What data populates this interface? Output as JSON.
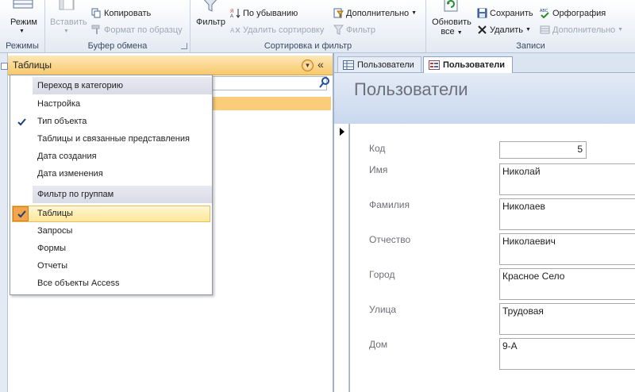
{
  "ribbon": {
    "views": {
      "button": "Режим",
      "group_label": "Режимы"
    },
    "clipboard": {
      "paste": "Вставить",
      "copy": "Копировать",
      "format_painter": "Формат по образцу",
      "group_label": "Буфер обмена"
    },
    "sort_filter": {
      "filter": "Фильтр",
      "descending": "По убыванию",
      "remove_sort": "Удалить сортировку",
      "advanced": "Дополнительно",
      "toggle_filter": "Фильтр",
      "group_label": "Сортировка и фильтр"
    },
    "records": {
      "refresh_line1": "Обновить",
      "refresh_line2": "все",
      "save": "Сохранить",
      "delete": "Удалить",
      "spelling": "Орфография",
      "more": "Дополнительно",
      "group_label": "Записи"
    }
  },
  "nav": {
    "title": "Таблицы",
    "menu": {
      "section1": "Переход в категорию",
      "items1": [
        "Настройка",
        "Тип объекта",
        "Таблицы и связанные представления",
        "Дата создания",
        "Дата изменения"
      ],
      "section2": "Фильтр по группам",
      "items2": [
        "Таблицы",
        "Запросы",
        "Формы",
        "Отчеты",
        "Все объекты Access"
      ]
    }
  },
  "tabs": [
    {
      "label": "Пользователи"
    },
    {
      "label": "Пользователи"
    }
  ],
  "form": {
    "title": "Пользователи",
    "fields": [
      {
        "label": "Код",
        "value": "5"
      },
      {
        "label": "Имя",
        "value": "Николай"
      },
      {
        "label": "Фамилия",
        "value": "Николаев"
      },
      {
        "label": "Отчество",
        "value": "Николаевич"
      },
      {
        "label": "Город",
        "value": "Красное Село"
      },
      {
        "label": "Улица",
        "value": "Трудовая"
      },
      {
        "label": "Дом",
        "value": "9-А"
      }
    ]
  },
  "colors": {
    "nav_header": "#f7c96c",
    "selected_menu": "#fde79a",
    "form_header": "#c9d8ee",
    "accent_check": "#f4a54b"
  }
}
